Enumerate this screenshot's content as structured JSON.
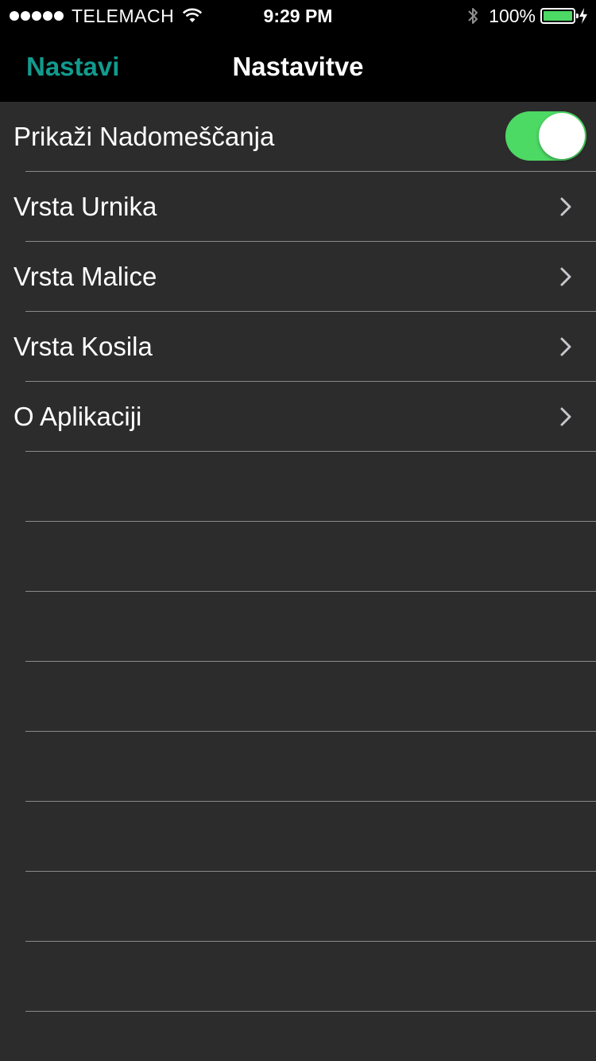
{
  "status_bar": {
    "carrier": "TELEMACH",
    "time": "9:29 PM",
    "battery_percent": "100%",
    "battery_level": 1.0,
    "signal_bars": 5,
    "icons": [
      "signal-dots-icon",
      "wifi-icon",
      "bluetooth-icon",
      "battery-icon",
      "charging-icon"
    ]
  },
  "nav": {
    "back_label": "Nastavi",
    "title": "Nastavitve"
  },
  "colors": {
    "accent": "#119b8e",
    "toggle_on": "#4cd964",
    "list_background": "#2c2c2c",
    "bar_background": "#000000",
    "separator": "#8a8a8a"
  },
  "settings": {
    "items": [
      {
        "label": "Prikaži Nadomeščanja",
        "type": "toggle",
        "value": true
      },
      {
        "label": "Vrsta Urnika",
        "type": "disclosure",
        "icon": "chevron-right-icon"
      },
      {
        "label": "Vrsta Malice",
        "type": "disclosure",
        "icon": "chevron-right-icon"
      },
      {
        "label": "Vrsta Kosila",
        "type": "disclosure",
        "icon": "chevron-right-icon"
      },
      {
        "label": "O Aplikaciji",
        "type": "disclosure",
        "icon": "chevron-right-icon"
      }
    ]
  }
}
